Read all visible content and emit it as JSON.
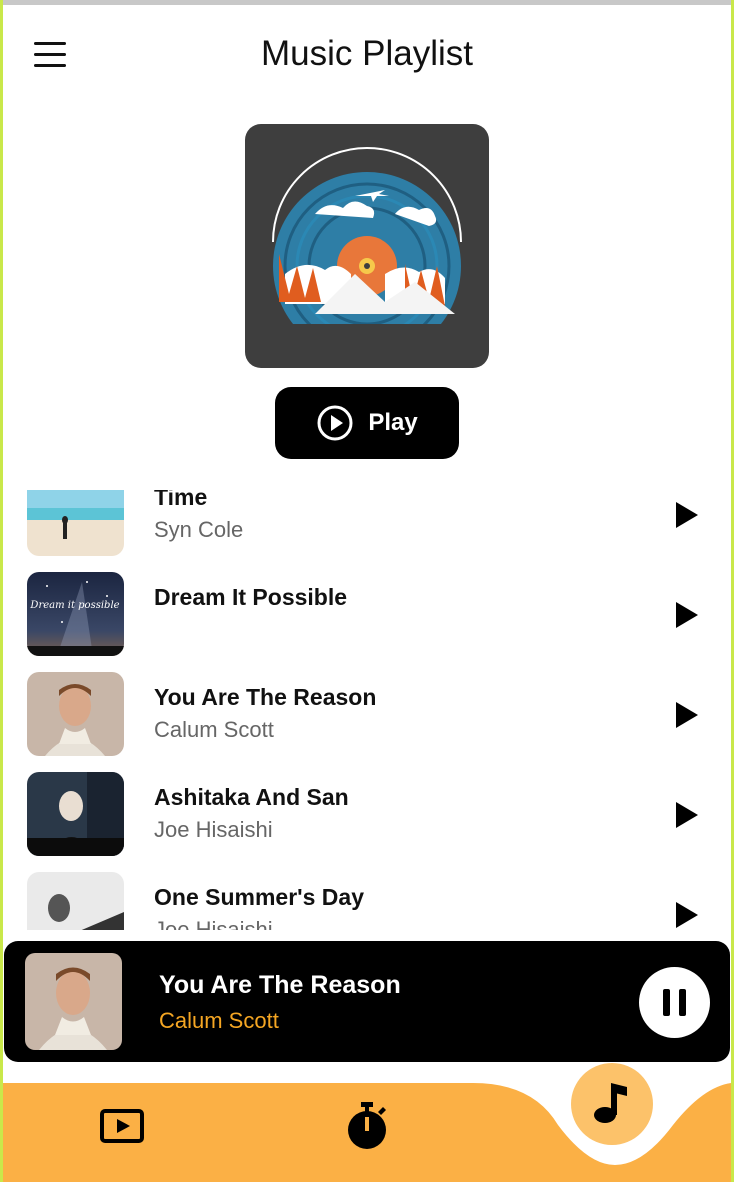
{
  "header": {
    "title": "Music Playlist",
    "menu_icon": "hamburger-menu-icon"
  },
  "hero": {
    "cover_icon": "vinyl-record-art",
    "play_label": "Play",
    "play_icon": "play-circle-icon"
  },
  "playlist": [
    {
      "title": "Time",
      "artist": "Syn Cole"
    },
    {
      "title": "Dream It Possible",
      "artist": ""
    },
    {
      "title": "You Are The Reason",
      "artist": "Calum Scott"
    },
    {
      "title": "Ashitaka And San",
      "artist": "Joe Hisaishi"
    },
    {
      "title": "One Summer's Day",
      "artist": "Joe Hisaishi"
    }
  ],
  "now_playing": {
    "title": "You Are The Reason",
    "artist": "Calum Scott",
    "control_icon": "pause-icon"
  },
  "bottom_nav": {
    "items": [
      "video-player-icon",
      "stopwatch-icon",
      "music-note-icon"
    ],
    "active": "music-note-icon"
  },
  "colors": {
    "accent": "#f5a623",
    "nav_bg": "#fbb045",
    "fab_bg": "#fcc26a",
    "dark": "#000000"
  }
}
